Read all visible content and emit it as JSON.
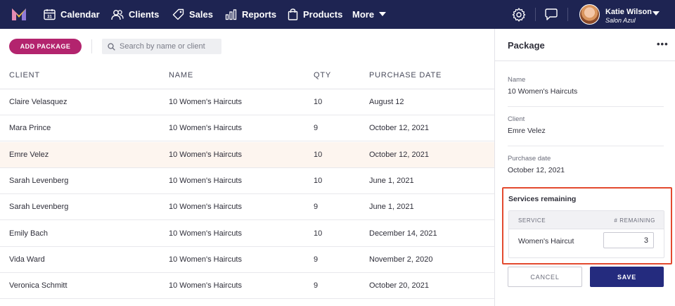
{
  "nav": {
    "items": [
      {
        "label": "Calendar",
        "icon": "calendar-icon"
      },
      {
        "label": "Clients",
        "icon": "clients-icon"
      },
      {
        "label": "Sales",
        "icon": "tag-icon"
      },
      {
        "label": "Reports",
        "icon": "bar-chart-icon"
      },
      {
        "label": "Products",
        "icon": "shopping-bag-icon"
      },
      {
        "label": "More",
        "icon": "chevron-down-icon"
      }
    ],
    "user": {
      "name": "Katie Wilson",
      "business": "Salon Azul"
    }
  },
  "toolbar": {
    "add_label": "ADD PACKAGE",
    "search_placeholder": "Search by name or client"
  },
  "table": {
    "columns": [
      "CLIENT",
      "NAME",
      "QTY",
      "PURCHASE DATE"
    ],
    "rows": [
      {
        "client": "Claire Velasquez",
        "name": "10 Women's Haircuts",
        "qty": "10",
        "date": "August 12"
      },
      {
        "client": "Mara Prince",
        "name": "10 Women's Haircuts",
        "qty": "9",
        "date": "October 12, 2021"
      },
      {
        "client": "Emre Velez",
        "name": "10 Women's Haircuts",
        "qty": "10",
        "date": "October 12, 2021"
      },
      {
        "client": "Sarah Levenberg",
        "name": "10 Women's Haircuts",
        "qty": "10",
        "date": "June 1, 2021"
      },
      {
        "client": "Sarah Levenberg",
        "name": "10 Women's Haircuts",
        "qty": "9",
        "date": "June 1, 2021"
      },
      {
        "client": "Emily Bach",
        "name": "10 Women's Haircuts",
        "qty": "10",
        "date": "December 14, 2021"
      },
      {
        "client": "Vida Ward",
        "name": "10 Women's Haircuts",
        "qty": "9",
        "date": "November 2, 2020"
      },
      {
        "client": "Veronica Schmitt",
        "name": "10 Women's Haircuts",
        "qty": "9",
        "date": "October 20, 2021"
      }
    ],
    "selected_row": 2
  },
  "panel": {
    "title": "Package",
    "more": "•••",
    "fields": [
      {
        "label": "Name",
        "value": "10 Women's Haircuts"
      },
      {
        "label": "Client",
        "value": "Emre Velez"
      },
      {
        "label": "Purchase date",
        "value": "October 12, 2021"
      }
    ],
    "services": {
      "title": "Services remaining",
      "col_service": "SERVICE",
      "col_remaining": "# REMAINING",
      "service_name": "Women's Haircut",
      "remaining": "3"
    },
    "cancel_label": "CANCEL",
    "save_label": "SAVE"
  },
  "colors": {
    "nav_bg": "#1e2452",
    "accent_pink": "#b3246e",
    "save_blue": "#242b7e",
    "highlight_border": "#e34a2f",
    "selected_row_bg": "#fdf5ef"
  }
}
